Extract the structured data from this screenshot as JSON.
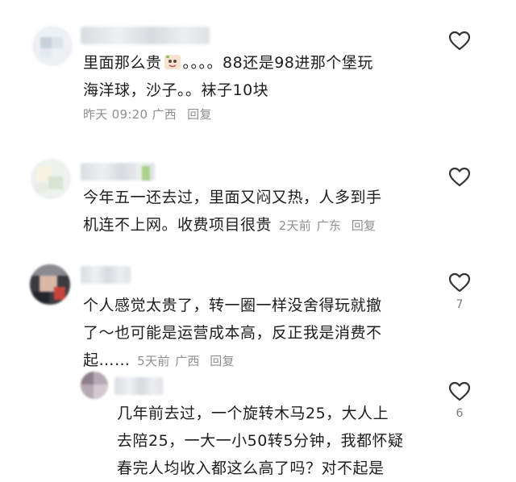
{
  "comments": [
    {
      "line1": "里面那么贵",
      "line1_after_sticker": "。。。。88还是98进那个堡玩",
      "line2": "海洋球，沙子。。袜子10块",
      "time": "昨天 09:20",
      "location": "广西",
      "reply_label": "回复",
      "likes": ""
    },
    {
      "line1": "今年五一还去过，里面又闷又热，人多到手",
      "line2": "机连不上网。收费项目很贵",
      "time": "2天前",
      "location": "广东",
      "reply_label": "回复",
      "likes": ""
    },
    {
      "line1": "个人感觉太贵了，转一圈一样没舍得玩就撤",
      "line2": "了～也可能是运营成本高，反正我是消费不",
      "line3": "起……",
      "time": "5天前",
      "location": "广西",
      "reply_label": "回复",
      "likes": "7"
    },
    {
      "line1": "几年前去过，一个旋转木马25，大人上",
      "line2": "去陪25，一大一小50转5分钟，我都怀疑",
      "line3": "春完人均收入都这么高了吗？对不起是",
      "likes": "6"
    }
  ],
  "icons": {
    "like": "heart-outline-icon",
    "sticker": "sticker-emoji-icon"
  },
  "colors": {
    "text": "#1d1d1d",
    "meta": "#8f8f8f",
    "icon": "#333333"
  }
}
